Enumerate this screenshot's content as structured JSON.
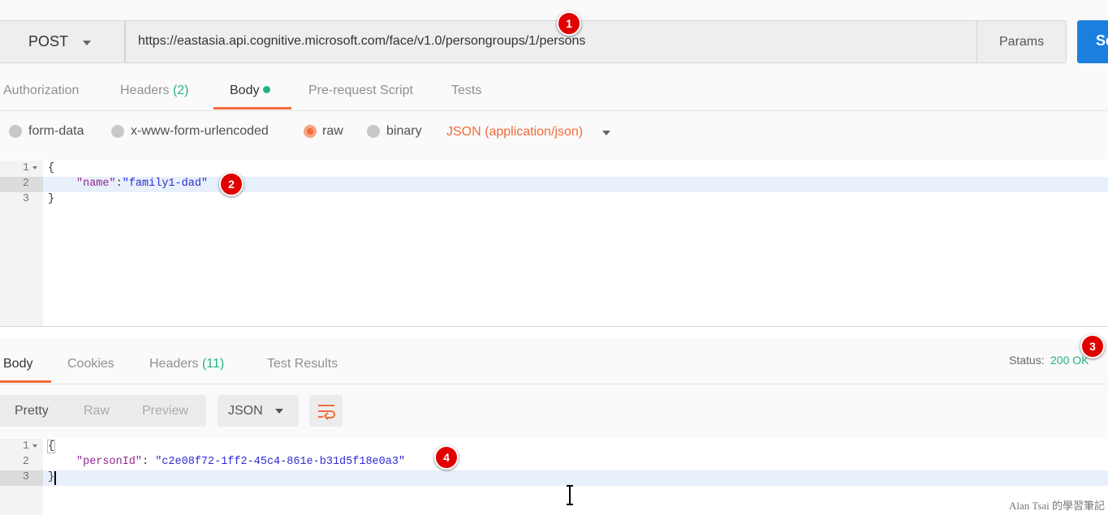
{
  "request": {
    "method": "POST",
    "url": "https://eastasia.api.cognitive.microsoft.com/face/v1.0/persongroups/1/persons",
    "params_label": "Params",
    "send_label": "Se"
  },
  "request_tabs": [
    {
      "label": "Authorization",
      "count": ""
    },
    {
      "label": "Headers",
      "count": "(2)"
    },
    {
      "label": "Body",
      "count": ""
    },
    {
      "label": "Pre-request Script",
      "count": ""
    },
    {
      "label": "Tests",
      "count": ""
    }
  ],
  "body_modes": [
    {
      "label": "form-data",
      "selected": false
    },
    {
      "label": "x-www-form-urlencoded",
      "selected": false
    },
    {
      "label": "raw",
      "selected": true
    },
    {
      "label": "binary",
      "selected": false
    }
  ],
  "content_type": "JSON (application/json)",
  "request_body": {
    "line_numbers": [
      "1",
      "2",
      "3"
    ],
    "open_brace": "{",
    "key": "\"name\"",
    "colon": ":",
    "value": "\"family1-dad\"",
    "close_brace": "}"
  },
  "response_tabs": [
    {
      "label": "Body",
      "count": ""
    },
    {
      "label": "Cookies",
      "count": ""
    },
    {
      "label": "Headers",
      "count": "(11)"
    },
    {
      "label": "Test Results",
      "count": ""
    }
  ],
  "status": {
    "label": "Status:",
    "value": "200 OK"
  },
  "view_modes": [
    "Pretty",
    "Raw",
    "Preview"
  ],
  "response_format": "JSON",
  "response_body": {
    "line_numbers": [
      "1",
      "2",
      "3"
    ],
    "open_brace": "{",
    "key": "\"personId\"",
    "colon": ": ",
    "value": "\"c2e08f72-1ff2-45c4-861e-b31d5f18e0a3\"",
    "close_brace": "}"
  },
  "markers": [
    "1",
    "2",
    "3",
    "4"
  ],
  "watermark": "Alan Tsai 的學習筆記",
  "colors": {
    "accent": "#f26b3a",
    "success": "#26b47f",
    "send": "#1b7fe0",
    "marker": "#e00000"
  }
}
